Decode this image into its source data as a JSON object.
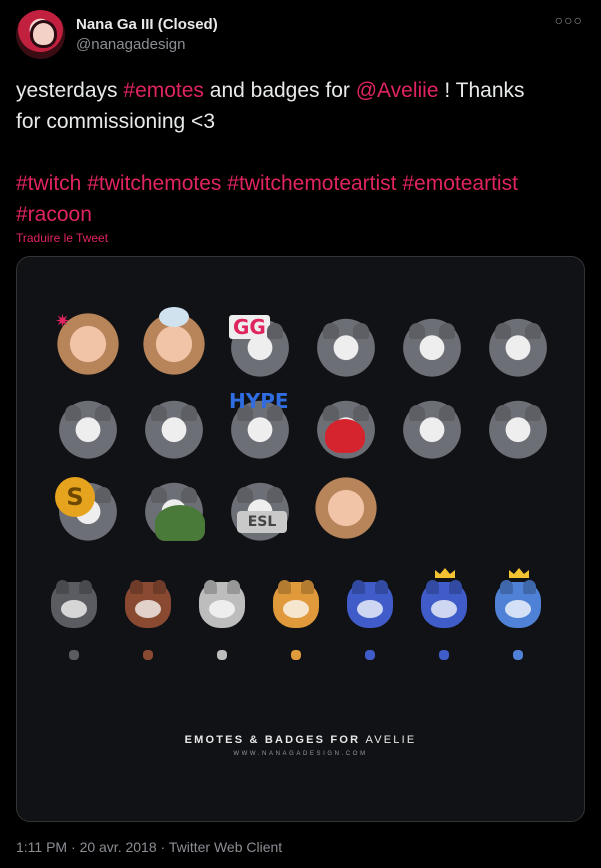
{
  "author": {
    "display_name": "Nana Ga III (Closed)",
    "handle": "@nanagadesign",
    "more_icon": "ellipsis-icon"
  },
  "tweet": {
    "line1_pre": "yesterdays ",
    "line1_tag": "#emotes",
    "line1_mid": " and badges for ",
    "line1_mention": "@Aveliie",
    "line1_post": " ! Thanks",
    "line2": "for commissioning <3",
    "tags": [
      "#twitch",
      "#twitchemotes",
      "#twitchemoteartist",
      "#emoteartist",
      "#racoon"
    ],
    "translate": "Traduire le Tweet"
  },
  "media": {
    "caption_pre": "EMOTES & BADGES FOR ",
    "caption_name": "AVELIE",
    "site": "WWW.NANAGADESIGN.COM",
    "emote_text": {
      "gg": "GG",
      "hype": "HYPE",
      "coin": "S",
      "sign": "ESL"
    },
    "badge_colors": [
      "#5b5c62",
      "#8a4a32",
      "#bdbdbd",
      "#e09a3c",
      "#3f5cc9",
      "#3f5cc9",
      "#4f82d6"
    ]
  },
  "meta": {
    "time": "1:11 PM",
    "date": "20 avr. 2018",
    "client": "Twitter Web Client",
    "sep": " · "
  }
}
